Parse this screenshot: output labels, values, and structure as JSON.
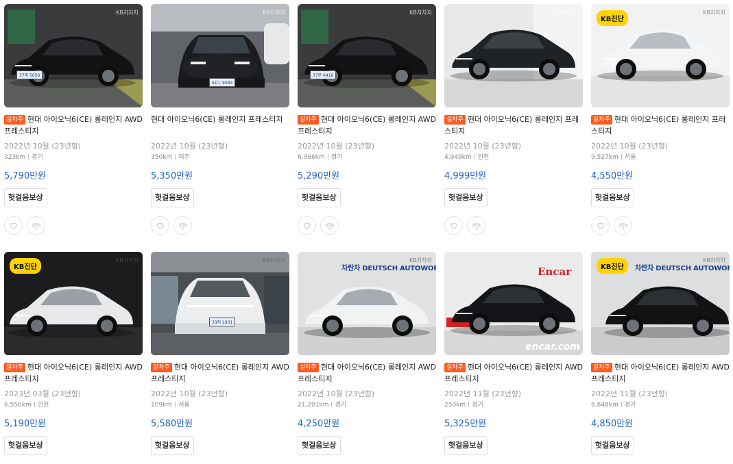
{
  "common": {
    "tag_label": "실차주",
    "inspect_button_label": "헛걸음보상",
    "kb_badge": "KB진단",
    "watermark": "KB차차차",
    "dealer_name": "차란차 DEUTSCH AUTOWORLD",
    "encar_logo": "Encar",
    "encar_watermark": "encar.com"
  },
  "listings": [
    {
      "title": "현대 아이오닉6(CE) 롱레인지 AWD 프레스티지",
      "has_tag": true,
      "year": "2022년 10월 (23년형)",
      "mileage": "323km",
      "region": "경기",
      "price": "5,790만원",
      "photo": "black-car",
      "has_kb": false,
      "plate": "37주 5056"
    },
    {
      "title": "현대 아이오닉6(CE) 롱레인지 프레스티지",
      "has_tag": false,
      "year": "2022년 10월 (23년형)",
      "mileage": "350km",
      "region": "제주",
      "price": "5,350만원",
      "photo": "black-front",
      "has_kb": false,
      "plate": "61누 9084"
    },
    {
      "title": "현대 아이오닉6(CE) 롱레인지 AWD 프레스티지",
      "has_tag": true,
      "year": "2022년 10월 (23년형)",
      "mileage": "6,986km",
      "region": "경기",
      "price": "5,290만원",
      "photo": "black-car",
      "has_kb": false,
      "plate": "37무 6416"
    },
    {
      "title": "현대 아이오닉6(CE) 롱레인지 프레스티지",
      "has_tag": true,
      "year": "2022년 10월 (23년형)",
      "mileage": "4,949km",
      "region": "인천",
      "price": "4,999만원",
      "photo": "dark-studio",
      "has_kb": false,
      "plate": ""
    },
    {
      "title": "현대 아이오닉6(CE) 롱레인지 프레스티지",
      "has_tag": true,
      "year": "2022년 10월 (23년형)",
      "mileage": "9,527km",
      "region": "서울",
      "price": "4,550만원",
      "photo": "white-studio",
      "has_kb": true,
      "plate": ""
    },
    {
      "title": "현대 아이오닉6(CE) 롱레인지 AWD 프레스티지",
      "has_tag": true,
      "year": "2023년 03월 (23년형)",
      "mileage": "6,556km",
      "region": "인천",
      "price": "5,190만원",
      "photo": "white-dark",
      "has_kb": true,
      "plate": ""
    },
    {
      "title": "현대 아이오닉6(CE) 롱레인지 AWD 프레스티지",
      "has_tag": true,
      "year": "2022년 10월 (23년형)",
      "mileage": "109km",
      "region": "서울",
      "price": "5,580만원",
      "photo": "white-front",
      "has_kb": false,
      "plate": "33지 1931"
    },
    {
      "title": "현대 아이오닉6(CE) 롱레인지 AWD 프레스티지",
      "has_tag": true,
      "year": "2022년 10월 (23년형)",
      "mileage": "21,201km",
      "region": "경기",
      "price": "4,250만원",
      "photo": "white-dealer",
      "has_kb": false,
      "plate": ""
    },
    {
      "title": "현대 아이오닉6(CE) 롱레인지 AWD 프레스티지",
      "has_tag": true,
      "year": "2022년 11월 (23년형)",
      "mileage": "250km",
      "region": "경기",
      "price": "5,325만원",
      "photo": "black-encar",
      "has_kb": false,
      "plate": "Encar"
    },
    {
      "title": "현대 아이오닉6(CE) 롱레인지 AWD 프레스티지",
      "has_tag": true,
      "year": "2022년 11월 (23년형)",
      "mileage": "6,848km",
      "region": "경기",
      "price": "4,850만원",
      "photo": "black-dealer",
      "has_kb": true,
      "plate": ""
    }
  ],
  "colors": {
    "accent_price": "#2264c5",
    "tag_bg": "#ff5a1f",
    "kb_badge": "#ffd200"
  },
  "icons": {
    "favorite": "heart-icon",
    "compare": "scale-icon"
  }
}
